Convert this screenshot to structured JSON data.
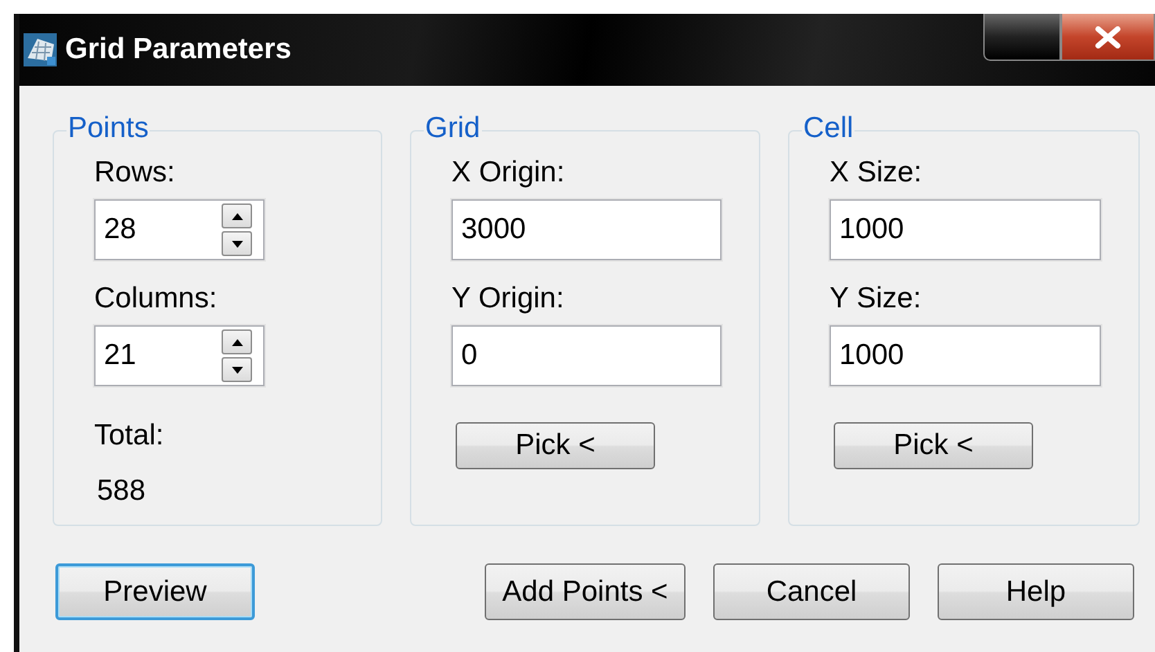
{
  "window": {
    "title": "Grid Parameters"
  },
  "groups": [
    {
      "title": "Points",
      "fields": [
        {
          "kind": "spin",
          "label": "Rows:",
          "value": "28"
        },
        {
          "kind": "spin",
          "label": "Columns:",
          "value": "21"
        },
        {
          "kind": "readout",
          "label": "Total:",
          "value": "588"
        }
      ]
    },
    {
      "title": "Grid",
      "fields": [
        {
          "kind": "text",
          "label": "X Origin:",
          "value": "3000"
        },
        {
          "kind": "text",
          "label": "Y Origin:",
          "value": "0"
        }
      ],
      "button": "Pick <"
    },
    {
      "title": "Cell",
      "fields": [
        {
          "kind": "text",
          "label": "X Size:",
          "value": "1000"
        },
        {
          "kind": "text",
          "label": "Y Size:",
          "value": "1000"
        }
      ],
      "button": "Pick <"
    }
  ],
  "buttons": [
    {
      "label": "Preview",
      "focused": true
    },
    {
      "label": "Add Points <",
      "focused": false
    },
    {
      "label": "Cancel",
      "focused": false
    },
    {
      "label": "Help",
      "focused": false
    }
  ]
}
